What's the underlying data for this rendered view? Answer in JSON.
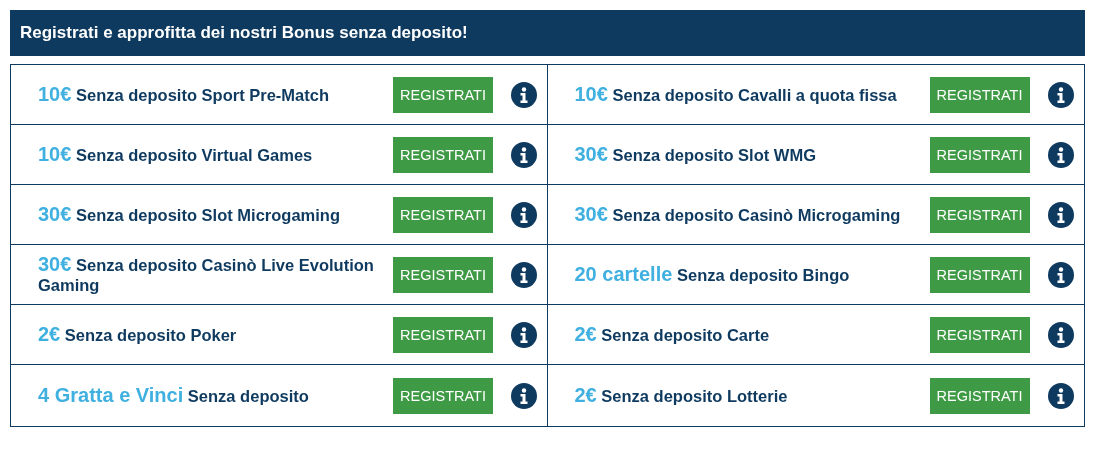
{
  "header": {
    "title": "Registrati e approfitta dei nostri Bonus senza deposito!"
  },
  "bonuses": [
    {
      "text": "**10€** Senza deposito Sport Pre-Match",
      "button": "REGISTRATI"
    },
    {
      "text": "**10€** Senza deposito Cavalli a quota fissa",
      "button": "REGISTRATI"
    },
    {
      "text": "**10€** Senza deposito Virtual Games",
      "button": "REGISTRATI"
    },
    {
      "text": "**30€** Senza deposito Slot WMG",
      "button": "REGISTRATI"
    },
    {
      "text": "**30€** Senza deposito Slot Microgaming",
      "button": "REGISTRATI"
    },
    {
      "text": "**30€** Senza deposito Casinò Microgaming",
      "button": "REGISTRATI"
    },
    {
      "text": "**30€** Senza deposito Casinò Live Evolution Gaming",
      "button": "REGISTRATI"
    },
    {
      "text": "**20 cartelle** Senza deposito Bingo",
      "button": "REGISTRATI"
    },
    {
      "text": "**2€** Senza deposito Poker",
      "button": "REGISTRATI"
    },
    {
      "text": "**2€** Senza deposito Carte",
      "button": "REGISTRATI"
    },
    {
      "text": "**4 Gratta e Vinci** Senza deposito",
      "button": "REGISTRATI"
    },
    {
      "text": "**2€** Senza deposito Lotterie",
      "button": "REGISTRATI"
    }
  ]
}
